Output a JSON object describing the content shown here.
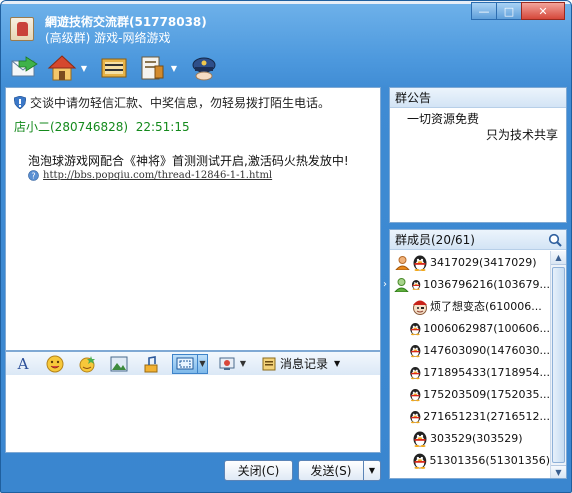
{
  "window": {
    "title": "網遊技術交流群(51778038)",
    "subtitle": "(高级群) 游戏-网络游戏",
    "controls": {
      "minimize": "—",
      "maximize": "□",
      "close": "✕"
    }
  },
  "toolbar": {
    "items": [
      {
        "icon": "mail-send-icon"
      },
      {
        "icon": "home-icon"
      },
      {
        "icon": "album-icon"
      },
      {
        "icon": "settings-doc-icon"
      },
      {
        "icon": "police-hat-icon"
      }
    ]
  },
  "chat": {
    "notice": "交谈中请勿轻信汇款、中奖信息，勿轻易拨打陌生电话。",
    "messages": [
      {
        "sender": "店小二(280746828)",
        "time": "22:51:15",
        "text": "泡泡球游戏网配合《神将》首测测试开启,激活码火热发放中!",
        "link": "http://bbs.popqiu.com/thread-12846-1-1.html"
      }
    ]
  },
  "format_bar": {
    "font_glyph": "A",
    "history_label": "消息记录"
  },
  "buttons": {
    "close": "关闭(C)",
    "send": "发送(S)"
  },
  "announcement": {
    "header": "群公告",
    "line1": "一切资源免费",
    "line2": "只为技术共享"
  },
  "members": {
    "header": "群成员(20/61)",
    "list": [
      {
        "name": "3417029(3417029)",
        "role": "owner"
      },
      {
        "name": "1036796216(103679...",
        "role": "admin"
      },
      {
        "name": "烦了想变态(610006...",
        "role": "member-special"
      },
      {
        "name": "1006062987(100606...",
        "role": "member"
      },
      {
        "name": "147603090(1476030...",
        "role": "member"
      },
      {
        "name": "171895433(1718954...",
        "role": "member"
      },
      {
        "name": "175203509(1752035...",
        "role": "member"
      },
      {
        "name": "271651231(2716512...",
        "role": "member"
      },
      {
        "name": "303529(303529)",
        "role": "member"
      },
      {
        "name": "51301356(51301356)",
        "role": "member"
      }
    ]
  },
  "colors": {
    "frame": "#4c98dd",
    "sender_green": "#148a1c",
    "panel_border": "#7fa9d4"
  }
}
